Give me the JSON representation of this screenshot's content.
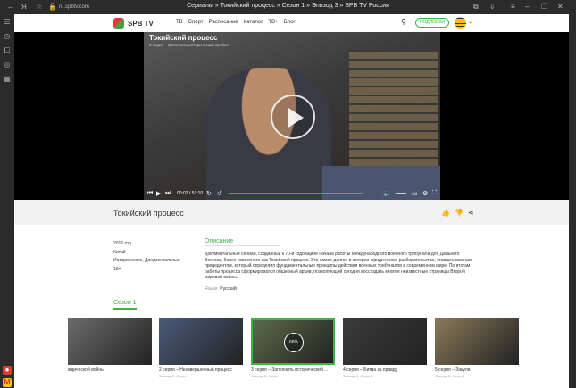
{
  "browser": {
    "url": "ru.spbtv.com",
    "tab_title": "Сериалы » Токийский процесс » Сезон 1 » Эпизод 3 » SPB TV Россия"
  },
  "site": {
    "logo_text": "SPB TV",
    "nav": [
      "ТВ",
      "Спорт",
      "Расписание",
      "Каталог",
      "ТВ+",
      "Блог"
    ],
    "subscribe_label": "ПОДПИСКИ"
  },
  "player": {
    "overlay_title": "Токийский процесс",
    "overlay_subtitle": "3 серия – Заполнить исторический пробел",
    "time": "00:02 / 51:10",
    "progress": 0.72
  },
  "show": {
    "title": "Токийский процесс",
    "year": "2016 год",
    "country": "Китай",
    "genres": "Исторические, Документальные",
    "age": "18+",
    "desc_heading": "Описание",
    "description": "Документальный сериал, созданный к 70-й годовщине начала работы Международного военного трибунала для Дальнего Востока, более известного как Токийский процесс. Это самое долгое в истории юридическое разбирательство, ставшее важным прецедентом, который определил фундаментальные принципы действия военных трибуналов в современном мире. По итогам работы процесса сформировался обширный архив, позволяющий сегодня воссоздать многие неизвестные страницы Второй мировой войны.",
    "lang_label": "Языки:",
    "lang_value": "Русский"
  },
  "season": {
    "label": "Сезон 1",
    "episodes": [
      {
        "title": "ждической войны",
        "sub": "",
        "color": "#6b6b6b"
      },
      {
        "title": "2 серия – Незавершенный процесс",
        "sub": "Эпизод 2, Сезон 1",
        "color": "#4a5a7a"
      },
      {
        "title": "3 серия – Заполнить исторический ...",
        "sub": "Эпизод 3, Сезон 1",
        "color": "#5b6b4a",
        "badge": "66%"
      },
      {
        "title": "4 серия – Битва за правду",
        "sub": "Эпизод 4, Сезон 1",
        "color": "#3a3a3a"
      },
      {
        "title": "5 серия – Закули",
        "sub": "Эпизод 5, Сезон 1",
        "color": "#8a7a5a"
      }
    ]
  }
}
